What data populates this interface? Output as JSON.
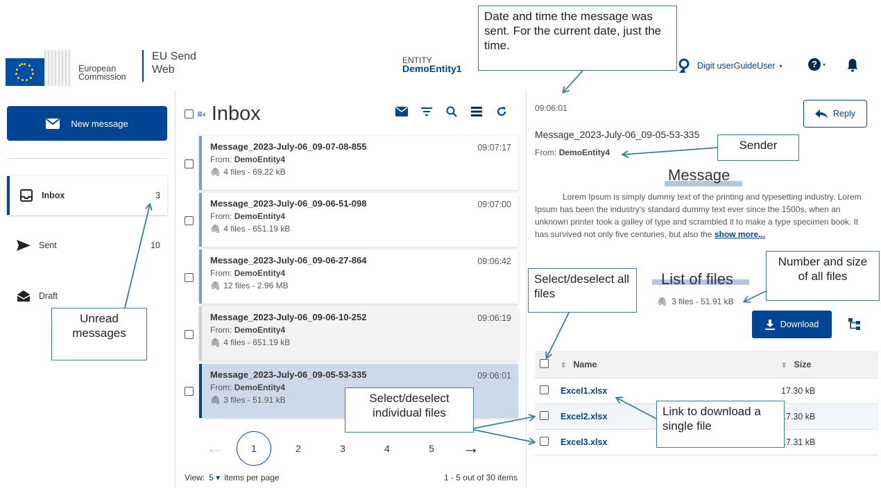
{
  "header": {
    "org_line1": "European",
    "org_line2": "Commission",
    "app_line1": "EU Send",
    "app_line2": "Web",
    "entity_label": "ENTITY",
    "entity_name": "DemoEntity1",
    "user_name": "Digit userGuideUser",
    "help": "?"
  },
  "sidebar": {
    "new_message": "New message",
    "items": [
      {
        "label": "Inbox",
        "count": "3"
      },
      {
        "label": "Sent",
        "count": "10"
      },
      {
        "label": "Draft",
        "count": ""
      }
    ]
  },
  "list": {
    "title": "Inbox",
    "messages": [
      {
        "subject": "Message_2023-July-06_09-07-08-855",
        "time": "09:07:17",
        "from_label": "From:",
        "from": "DemoEntity4",
        "files": "4 files - 69.22 kB"
      },
      {
        "subject": "Message_2023-July-06_09-06-51-098",
        "time": "09:07:00",
        "from_label": "From:",
        "from": "DemoEntity4",
        "files": "4 files - 651.19 kB"
      },
      {
        "subject": "Message_2023-July-06_09-06-27-864",
        "time": "09:06:42",
        "from_label": "From:",
        "from": "DemoEntity4",
        "files": "12 files - 2.96 MB"
      },
      {
        "subject": "Message_2023-July-06_09-06-10-252",
        "time": "09:06:19",
        "from_label": "From:",
        "from": "DemoEntity4",
        "files": "4 files - 651.19 kB"
      },
      {
        "subject": "Message_2023-July-06_09-05-53-335",
        "time": "09:06:01",
        "from_label": "From:",
        "from": "DemoEntity4",
        "files": "3 files - 51.91 kB"
      }
    ],
    "pages": [
      "1",
      "2",
      "3",
      "4",
      "5"
    ],
    "prev": "←",
    "next": "→",
    "view_label": "View:",
    "per_page": "5",
    "per_page_suffix": "items per page",
    "range": "1 - 5 out of 30 items"
  },
  "detail": {
    "time": "09:06:01",
    "reply": "Reply",
    "subject": "Message_2023-July-06_09-05-53-335",
    "from_label": "From:",
    "from": "DemoEntity4",
    "body": "Lorem Ipsum is simply dummy text of the printing and typesetting industry. Lorem Ipsum has been the industry's standard dummy text ever since the 1500s, when an unknown printer took a galley of type and scrambled it to make a type specimen book. It has survived not only five centuries, but also the ",
    "show_more": "show more...",
    "files_summary": "3 files - 51.91 kB",
    "download": "Download",
    "table_headers": {
      "name": "Name",
      "size": "Size"
    },
    "files": [
      {
        "name": "Excel1.xlsx",
        "size": "17.30 kB"
      },
      {
        "name": "Excel2.xlsx",
        "size": "17.30 kB"
      },
      {
        "name": "Excel3.xlsx",
        "size": "17.31 kB"
      }
    ]
  },
  "annotations": {
    "date_time": "Date and time the message was sent. For the current date, just the time.",
    "sender": "Sender",
    "message": "Message",
    "list_of_files": "List of files",
    "number_size": "Number and size of all files",
    "select_all": "Select/deselect all files",
    "unread": "Unread messages",
    "select_individual": "Select/deselect individual files",
    "link_download": "Link to download a single file"
  },
  "colors": {
    "primary": "#004494",
    "selected_row": "#ccd9eb",
    "callout_border": "#3a7d96"
  }
}
